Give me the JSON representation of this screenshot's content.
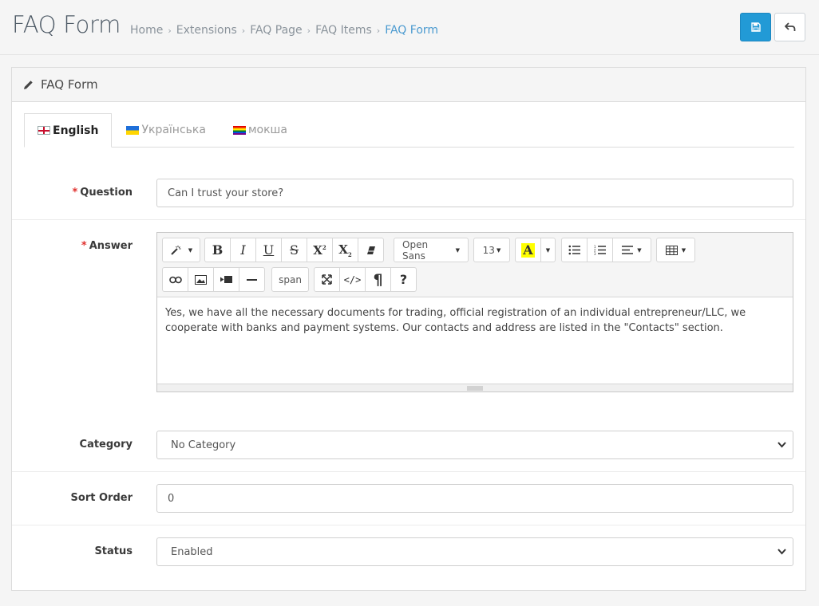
{
  "header": {
    "title": "FAQ Form",
    "breadcrumbs": [
      "Home",
      "Extensions",
      "FAQ Page",
      "FAQ Items",
      "FAQ Form"
    ]
  },
  "panel": {
    "heading": "FAQ Form"
  },
  "tabs": [
    {
      "label": "English",
      "active": true
    },
    {
      "label": "Українська",
      "active": false
    },
    {
      "label": "мокша",
      "active": false
    }
  ],
  "form": {
    "question": {
      "label": "Question",
      "value": "Can I trust your store?"
    },
    "answer": {
      "label": "Answer",
      "value": "Yes, we have all the necessary documents for trading, official registration of an individual entrepreneur/LLC, we cooperate with banks and payment systems. Our contacts and address are listed in the \"Contacts\" section."
    },
    "category": {
      "label": "Category",
      "value": "No Category"
    },
    "sort_order": {
      "label": "Sort Order",
      "value": "0"
    },
    "status": {
      "label": "Status",
      "value": "Enabled"
    }
  },
  "editor_toolbar": {
    "font_family": "Open Sans",
    "font_size": "13",
    "style_tag": "span"
  },
  "colors": {
    "primary": "#229ad6",
    "breadcrumb_active": "#4a9ad0",
    "required": "#e0312e"
  }
}
